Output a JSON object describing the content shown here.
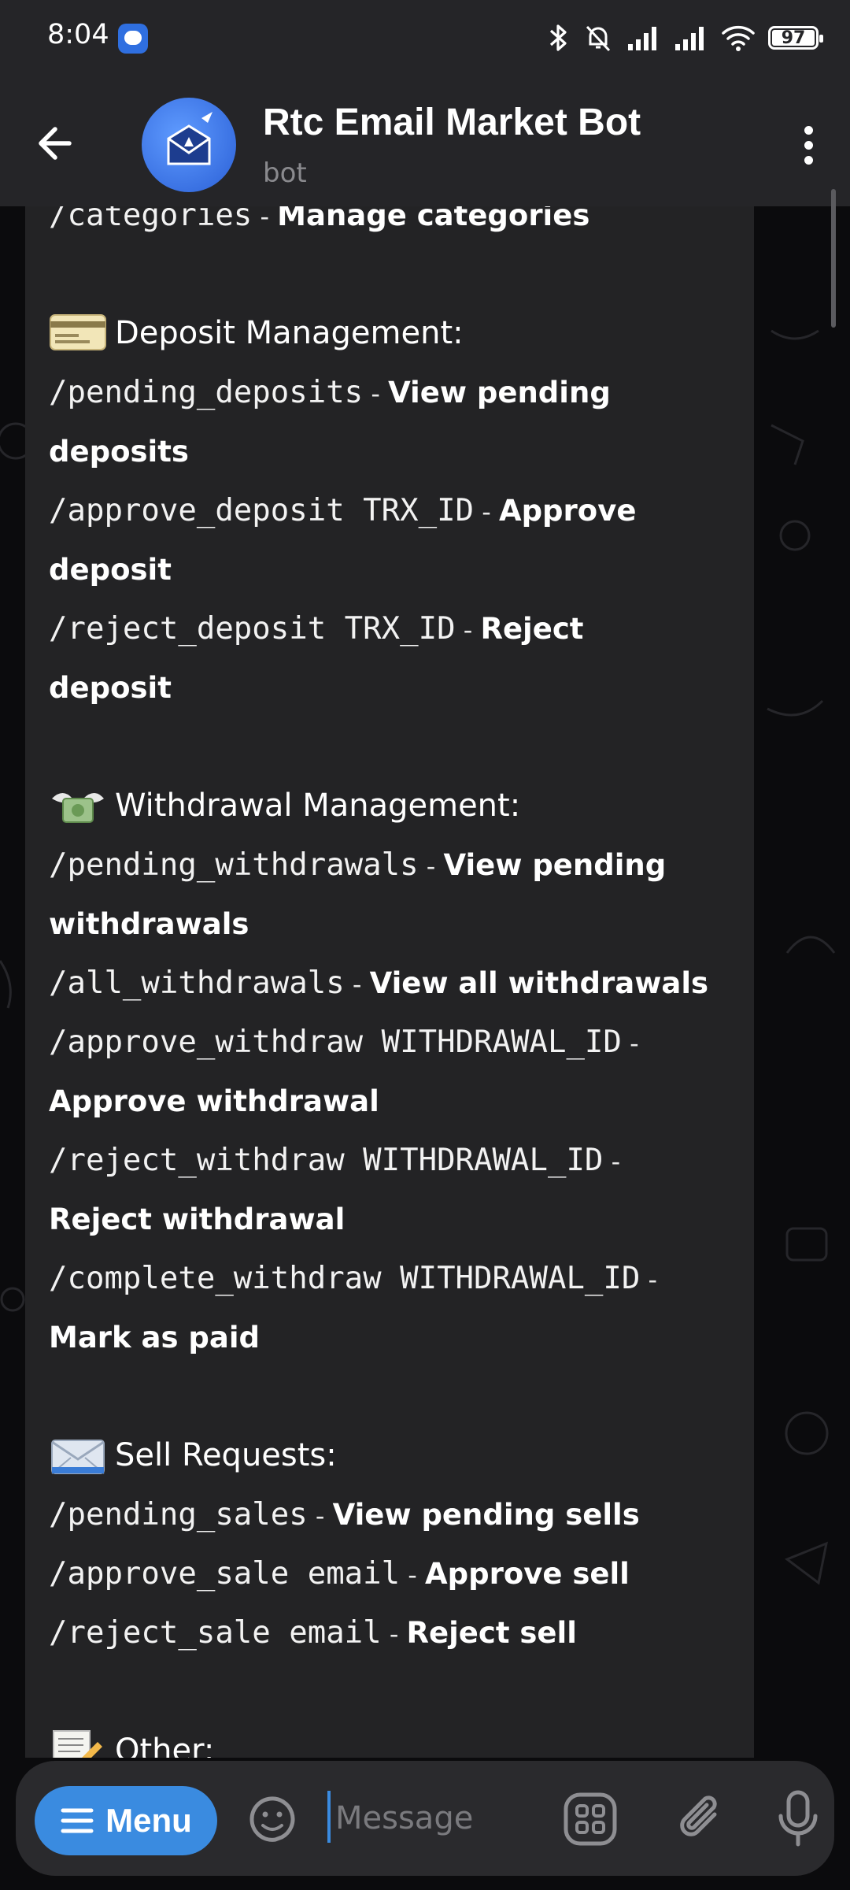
{
  "status_bar": {
    "time": "8:04",
    "battery": "97",
    "battery_level": 0.97
  },
  "header": {
    "title": "Rtc Email Market Bot",
    "subtitle": "bot"
  },
  "message": {
    "lines": [
      {
        "kind": "cmd",
        "cmd": "/categories",
        "desc": "Manage categories"
      },
      {
        "kind": "gap"
      },
      {
        "kind": "head",
        "emoji": "credit-card-icon",
        "text": "Deposit Management:"
      },
      {
        "kind": "cmd",
        "cmd": "/pending_deposits",
        "desc": "View pending"
      },
      {
        "kind": "cont",
        "desc": "deposits"
      },
      {
        "kind": "cmd",
        "cmd": "/approve_deposit TRX_ID",
        "desc": "Approve"
      },
      {
        "kind": "cont",
        "desc": "deposit"
      },
      {
        "kind": "cmd",
        "cmd": "/reject_deposit TRX_ID",
        "desc": "Reject"
      },
      {
        "kind": "cont",
        "desc": "deposit"
      },
      {
        "kind": "gap"
      },
      {
        "kind": "head",
        "emoji": "money-with-wings-icon",
        "text": "Withdrawal Management:"
      },
      {
        "kind": "cmd",
        "cmd": "/pending_withdrawals",
        "desc": "View pending"
      },
      {
        "kind": "cont",
        "desc": "withdrawals"
      },
      {
        "kind": "cmd",
        "cmd": "/all_withdrawals",
        "desc": "View all withdrawals"
      },
      {
        "kind": "cmd",
        "cmd": "/approve_withdraw WITHDRAWAL_ID",
        "desc": ""
      },
      {
        "kind": "cont",
        "desc": "Approve withdrawal"
      },
      {
        "kind": "cmd",
        "cmd": "/reject_withdraw WITHDRAWAL_ID",
        "desc": ""
      },
      {
        "kind": "cont",
        "desc": "Reject withdrawal"
      },
      {
        "kind": "cmd",
        "cmd": "/complete_withdraw WITHDRAWAL_ID",
        "desc": ""
      },
      {
        "kind": "cont",
        "desc": "Mark as paid"
      },
      {
        "kind": "gap"
      },
      {
        "kind": "head",
        "emoji": "incoming-envelope-icon",
        "text": "Sell Requests:"
      },
      {
        "kind": "cmd",
        "cmd": "/pending_sales",
        "desc": "View pending sells"
      },
      {
        "kind": "cmd",
        "cmd": "/approve_sale email",
        "desc": "Approve sell"
      },
      {
        "kind": "cmd",
        "cmd": "/reject_sale email",
        "desc": "Reject sell"
      },
      {
        "kind": "gap"
      },
      {
        "kind": "head",
        "emoji": "memo-icon",
        "text": "Other:"
      }
    ]
  },
  "input_bar": {
    "menu_label": "Menu",
    "placeholder": "Message"
  },
  "colors": {
    "accent": "#3a8be0",
    "bubble": "#232325",
    "header": "#252528"
  }
}
